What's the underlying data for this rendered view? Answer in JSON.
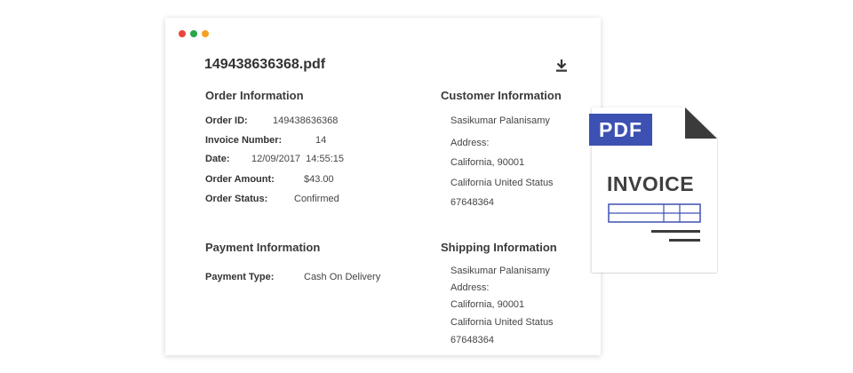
{
  "window": {
    "dot_colors": [
      "#e9453a",
      "#27a84a",
      "#f4a123"
    ],
    "file_name": "149438636368.pdf",
    "download_icon": "download-icon"
  },
  "order": {
    "heading": "Order Information",
    "fields": [
      {
        "label": "Order ID:",
        "value": "149438636368"
      },
      {
        "label": "Invoice Number:",
        "value": "14"
      },
      {
        "label": "Date:",
        "value": "12/09/2017  14:55:15"
      },
      {
        "label": "Order Amount:",
        "value": "$43.00"
      },
      {
        "label": "Order Status:",
        "value": "Confirmed"
      }
    ]
  },
  "customer": {
    "heading": "Customer Information",
    "lines": [
      "Sasikumar Palanisamy",
      "Address:",
      "California, 90001",
      "California United Status",
      "67648364"
    ]
  },
  "payment": {
    "heading": "Payment Information",
    "type_label": "Payment Type:",
    "type_value": "Cash On Delivery"
  },
  "shipping": {
    "heading": "Shipping Information",
    "lines": [
      "Sasikumar Palanisamy",
      "Address:",
      "California, 90001",
      "California United Status",
      "67648364"
    ]
  },
  "pdf_illustration": {
    "badge": "PDF",
    "title": "INVOICE",
    "badge_color": "#3d51b2",
    "table_color": "#3d51b2"
  }
}
